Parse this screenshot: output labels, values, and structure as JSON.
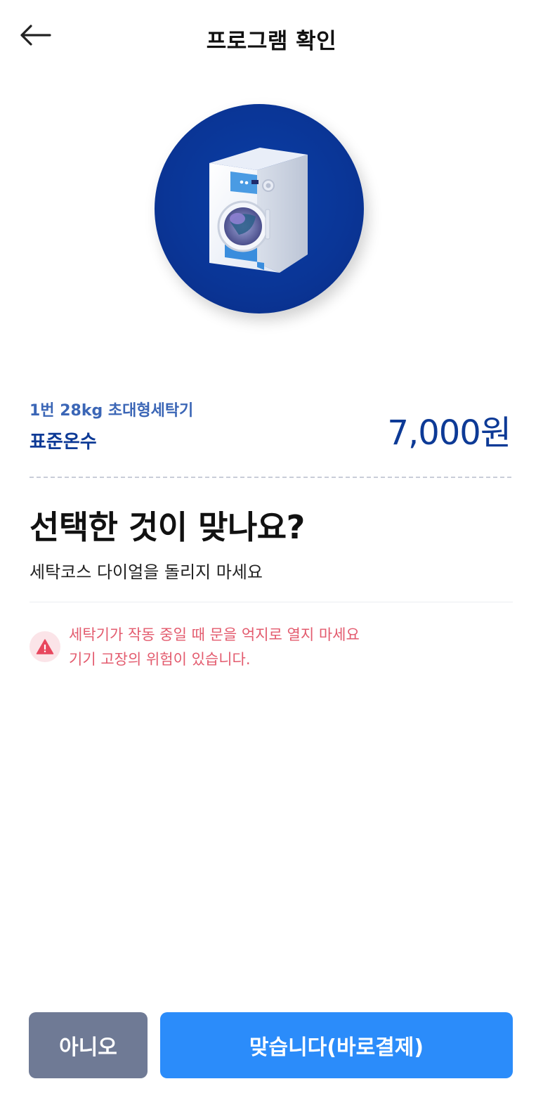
{
  "header": {
    "title": "프로그램 확인",
    "back_icon": "arrow-left-icon"
  },
  "hero": {
    "icon": "washing-machine-icon",
    "circle_color": "#0a3596"
  },
  "product": {
    "machine_name": "1번 28kg 초대형세탁기",
    "course_name": "표준온수",
    "price": "7,000원"
  },
  "confirm": {
    "question": "선택한 것이 맞나요?",
    "subtext": "세탁코스 다이얼을 돌리지 마세요"
  },
  "warning": {
    "icon": "warning-triangle-icon",
    "line1": "세탁기가 작동 중일 때 문을 억지로 열지 마세요",
    "line2": "기기 고장의 위험이 있습니다.",
    "color": "#e35b6e"
  },
  "actions": {
    "no_label": "아니오",
    "yes_label": "맞습니다(바로결제)",
    "no_color": "#6f7a95",
    "yes_color": "#2b8cfa"
  }
}
